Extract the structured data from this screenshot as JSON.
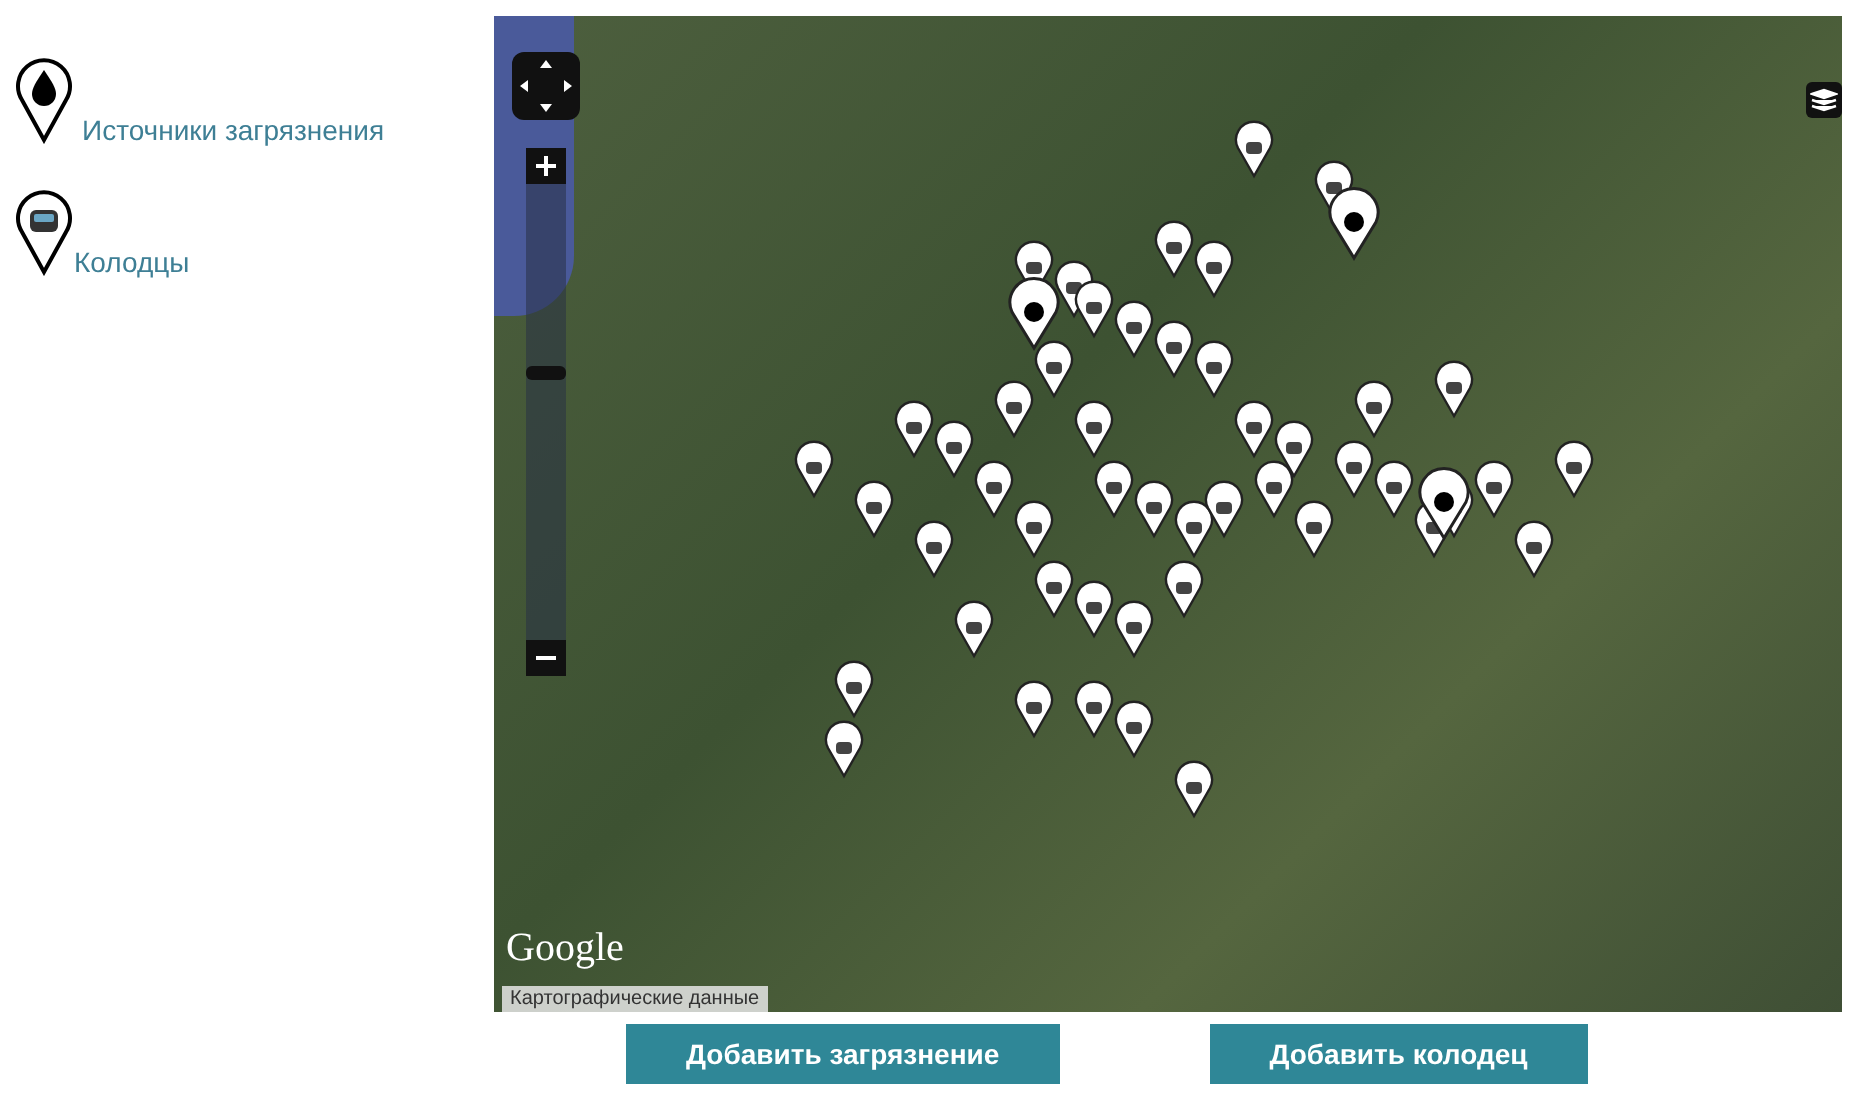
{
  "legend": [
    {
      "kind": "pollution",
      "label": "Источники загрязнения"
    },
    {
      "kind": "well",
      "label": "Колодцы"
    }
  ],
  "map": {
    "zoom": {
      "level": 0.6
    },
    "logo": "Google",
    "attribution": "Картографические данные"
  },
  "buttons": [
    "Добавить загрязнение",
    "Добавить колодец"
  ]
}
